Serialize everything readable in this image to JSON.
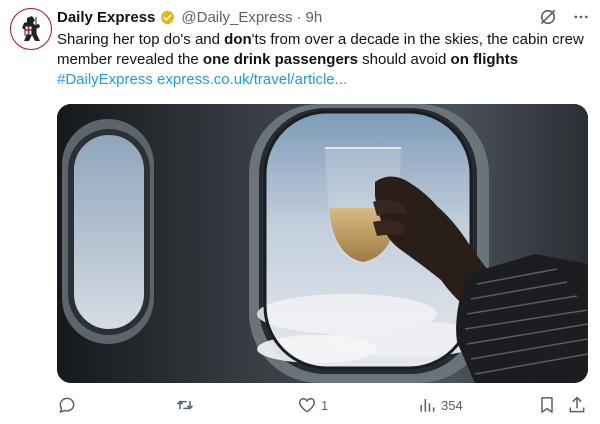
{
  "tweet": {
    "author": {
      "display_name": "Daily Express",
      "handle": "@Daily_Express",
      "separator": "·",
      "time": "9h",
      "avatar_icon": "crusader-knight-logo",
      "verified_color": "#e2b719"
    },
    "text": {
      "part1": "Sharing her top do's and ",
      "bold1": "don",
      "part2": "'ts from over a decade in the skies, the cabin crew member revealed the ",
      "bold2": "one drink passengers",
      "part3": " should avoid ",
      "bold3": "on flights",
      "hashtag": "#DailyExpress",
      "link": "express.co.uk/travel/article..."
    },
    "media": {
      "icon": "airplane-window-photo"
    },
    "actions": {
      "reply": {
        "icon": "reply-icon",
        "count": ""
      },
      "retweet": {
        "icon": "retweet-icon",
        "count": ""
      },
      "like": {
        "icon": "heart-icon",
        "count": "1"
      },
      "views": {
        "icon": "views-icon",
        "count": "354"
      },
      "bookmark": {
        "icon": "bookmark-icon",
        "count": ""
      },
      "share": {
        "icon": "share-icon",
        "count": ""
      }
    },
    "colors": {
      "link": "#1d9bf0",
      "secondary_text": "#536471",
      "primary_text": "#0f1419"
    }
  }
}
